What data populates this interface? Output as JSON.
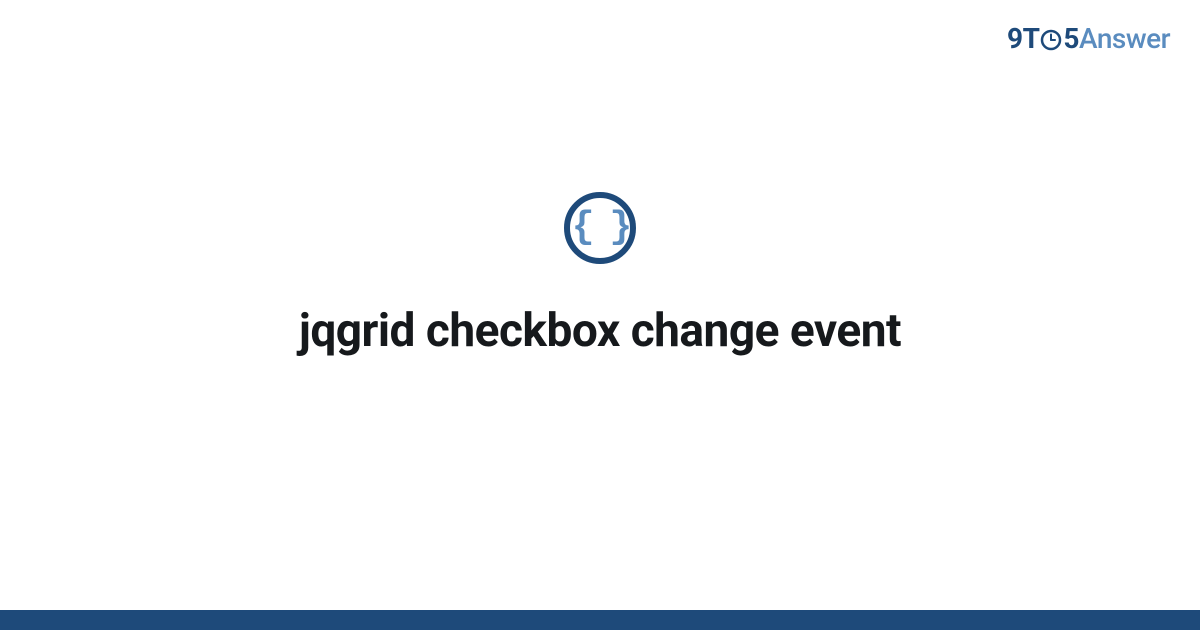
{
  "brand": {
    "part1": "9",
    "part2": "T",
    "part3": "5",
    "part4": "Answer"
  },
  "category": {
    "icon_symbol": "{ }",
    "icon_name": "braces-icon"
  },
  "title": "jqgrid checkbox change event",
  "colors": {
    "primary": "#1e4a7a",
    "secondary": "#5a8cbf",
    "text": "#16191c"
  }
}
